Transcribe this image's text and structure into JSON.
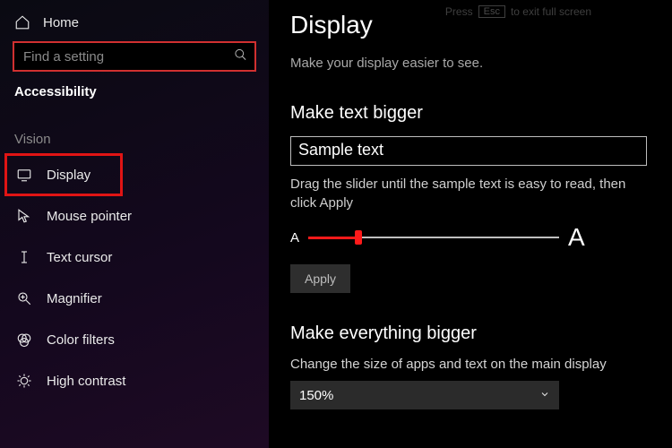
{
  "sidebar": {
    "home": "Home",
    "search_placeholder": "Find a setting",
    "section": "Accessibility",
    "group": "Vision",
    "items": [
      {
        "label": "Display",
        "selected": true
      },
      {
        "label": "Mouse pointer"
      },
      {
        "label": "Text cursor"
      },
      {
        "label": "Magnifier"
      },
      {
        "label": "Color filters"
      },
      {
        "label": "High contrast"
      }
    ]
  },
  "main": {
    "title": "Display",
    "subtitle": "Make your display easier to see.",
    "hint_press": "Press",
    "hint_esc": "Esc",
    "hint_rest": "to exit full screen",
    "text_section": {
      "heading": "Make text bigger",
      "sample": "Sample text",
      "helper": "Drag the slider until the sample text is easy to read, then click Apply",
      "a_small": "A",
      "a_large": "A",
      "apply": "Apply"
    },
    "everything_section": {
      "heading": "Make everything bigger",
      "helper": "Change the size of apps and text on the main display",
      "value": "150%"
    }
  }
}
